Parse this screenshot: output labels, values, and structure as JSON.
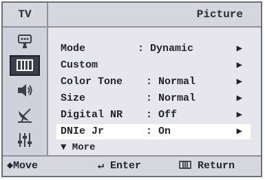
{
  "header": {
    "source": "TV",
    "title": "Picture"
  },
  "sidebar": [
    {
      "icon": "input-icon"
    },
    {
      "icon": "picture-icon",
      "selected": true
    },
    {
      "icon": "sound-icon"
    },
    {
      "icon": "channel-icon"
    },
    {
      "icon": "setup-icon"
    }
  ],
  "menu": {
    "items": [
      {
        "label": "Mode",
        "value": ": Dynamic"
      },
      {
        "label": "Custom",
        "value": ""
      },
      {
        "label": "Color Tone",
        "value": ": Normal"
      },
      {
        "label": "Size",
        "value": ": Normal"
      },
      {
        "label": "Digital NR",
        "value": ": Off"
      },
      {
        "label": "DNIe Jr",
        "value": ": On",
        "selected": true
      }
    ],
    "arrow": "▶",
    "more": "▼ More"
  },
  "footer": {
    "move_icon": "◆",
    "move": "Move",
    "enter_icon": "↵",
    "enter": "Enter",
    "return": "Return"
  },
  "colors": {
    "selected_row": "#ffffff",
    "background": "#e6e6ec",
    "bar": "#d5d6de"
  }
}
